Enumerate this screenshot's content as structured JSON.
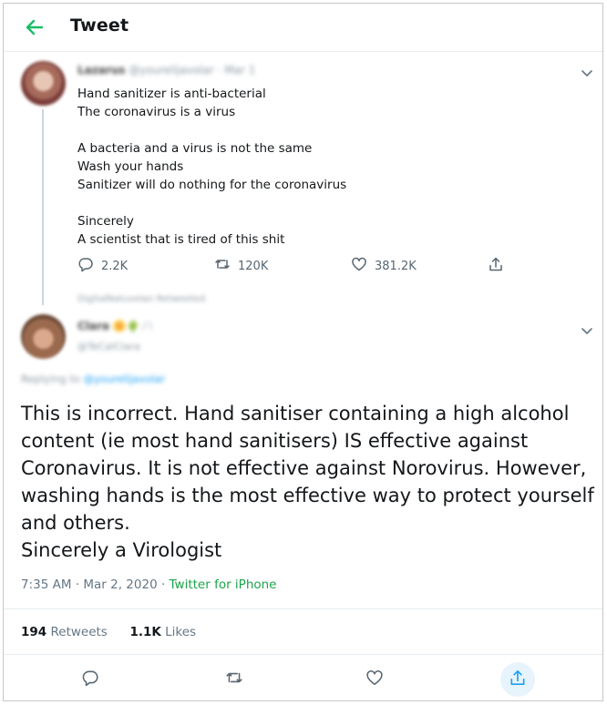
{
  "header": {
    "title": "Tweet"
  },
  "original_tweet": {
    "display_name": "Lazarus",
    "handle_line": "@yourelijavolar · Mar 1",
    "lines": [
      "Hand sanitizer is anti-bacterial",
      "The coronavirus is a virus",
      "",
      "A bacteria and a virus is not the same",
      "Wash your hands",
      "Sanitizer will do nothing for the coronavirus",
      "",
      "Sincerely",
      "A scientist that is tired of this shit"
    ],
    "replies": "2.2K",
    "retweets": "120K",
    "likes": "381.2K",
    "retweeted_by": "DigitalNatuvelan Retweeted"
  },
  "reply_tweet": {
    "display_name": "Clara",
    "handle": "@TeCalClara",
    "replying_prefix": "Replying to",
    "replying_handle": "@yourelijavolar",
    "lines": [
      "This is incorrect. Hand sanitiser containing a high alcohol",
      "content (ie most hand sanitisers) IS effective against",
      "Coronavirus. It is not effective against Norovirus. However,",
      "washing hands is the most effective way to protect yourself",
      "and others.",
      "Sincerely a Virologist"
    ],
    "timestamp": "7:35 AM · Mar 2, 2020 · ",
    "source": "Twitter for iPhone",
    "retweet_count": "194",
    "retweet_label": "Retweets",
    "like_count": "1.1K",
    "like_label": "Likes"
  },
  "colors": {
    "accent": "#1da1f2",
    "back_arrow": "#17bf63",
    "source_link": "#1aa54a"
  },
  "icons": [
    "back-arrow-icon",
    "chevron-down-icon",
    "reply-icon",
    "retweet-icon",
    "like-icon",
    "share-icon"
  ]
}
